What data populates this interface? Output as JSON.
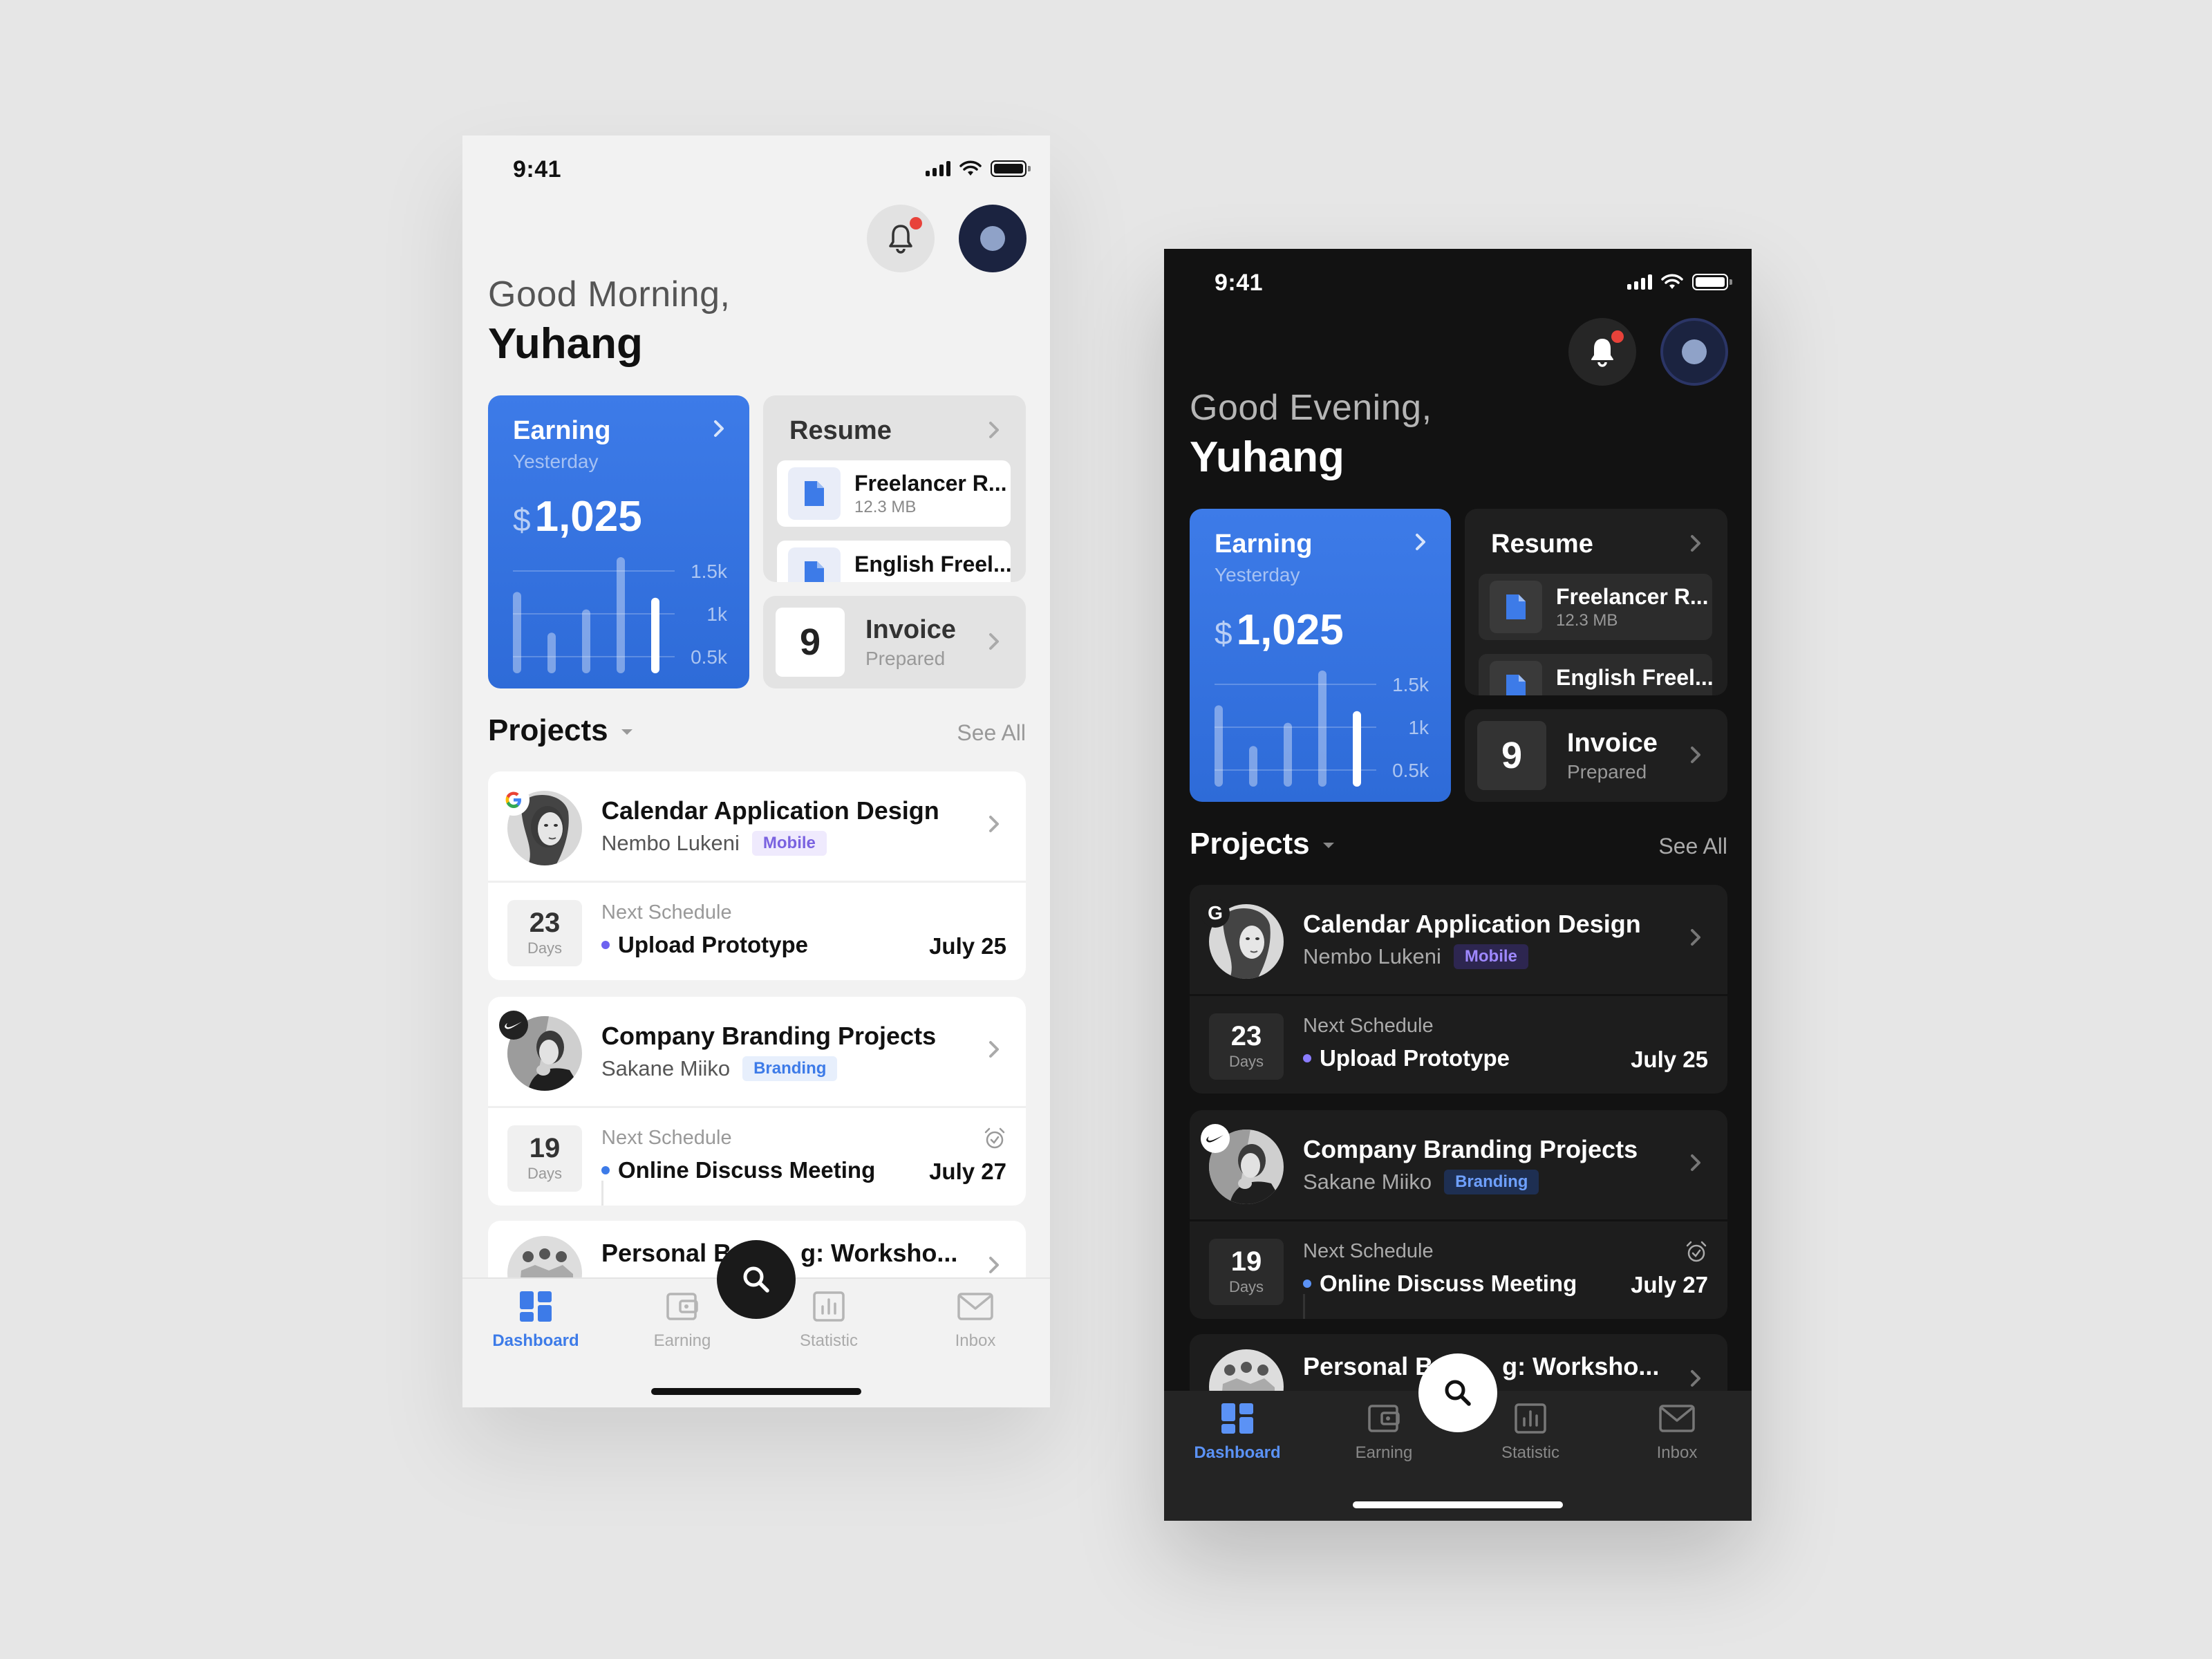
{
  "status": {
    "time": "9:41"
  },
  "light": {
    "greeting": "Good Morning,",
    "name": "Yuhang"
  },
  "dark": {
    "greeting": "Good Evening,",
    "name": "Yuhang"
  },
  "earning": {
    "title": "Earning",
    "subtitle": "Yesterday",
    "currency": "$",
    "amount": "1,025",
    "chart_data": {
      "type": "bar",
      "y_ticks": [
        "1.5k",
        "1k",
        "0.5k"
      ],
      "values": [
        0.7,
        0.35,
        0.55,
        1.0,
        0.65
      ],
      "highlight_index": 4
    }
  },
  "resume": {
    "title": "Resume",
    "files": [
      {
        "name": "Freelancer R...",
        "size": "12.3 MB"
      },
      {
        "name": "English Freel...",
        "size": ""
      }
    ]
  },
  "invoice": {
    "count": "9",
    "title": "Invoice",
    "subtitle": "Prepared"
  },
  "projects": {
    "title": "Projects",
    "see_all": "See All",
    "items": [
      {
        "title": "Calendar Application Design",
        "owner": "Nembo Lukeni",
        "tag": "Mobile",
        "brand": "G",
        "days": "23",
        "days_label": "Days",
        "schedule_label": "Next Schedule",
        "task": "Upload Prototype",
        "date": "July 25"
      },
      {
        "title": "Company Branding Projects",
        "owner": "Sakane Miiko",
        "tag": "Branding",
        "brand": "nike",
        "days": "19",
        "days_label": "Days",
        "schedule_label": "Next Schedule",
        "task": "Online Discuss Meeting",
        "date": "July 27"
      },
      {
        "title": "Personal B      g: Worksho...",
        "title_left": "Personal B",
        "title_right": "g: Worksho..."
      }
    ]
  },
  "tabs": [
    {
      "label": "Dashboard",
      "icon": "dashboard-icon",
      "active": true
    },
    {
      "label": "Earning",
      "icon": "wallet-icon",
      "active": false
    },
    {
      "label": "Statistic",
      "icon": "statistic-icon",
      "active": false
    },
    {
      "label": "Inbox",
      "icon": "mail-icon",
      "active": false
    }
  ],
  "colors": {
    "accent": "#3d7be8",
    "notification": "#e8423a",
    "mobile_tag": "#7a62e0",
    "light_bg": "#f2f2f2",
    "dark_bg": "#121212",
    "page_bg": "#e6e6e6"
  }
}
